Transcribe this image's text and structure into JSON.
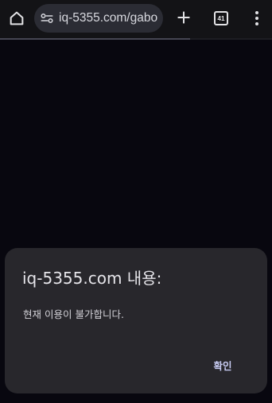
{
  "browser": {
    "url_display": "iq-5355.com/gabo",
    "tab_count": "41",
    "page_load_progress": 0.7,
    "icons": {
      "home": "home-icon",
      "site_info": "tune-icon",
      "new_tab": "plus-icon",
      "tabs": "tab-switcher-icon",
      "menu": "more-vert-icon"
    }
  },
  "dialog": {
    "title": "iq-5355.com 내용:",
    "message": "현재 이용이 불가합니다.",
    "ok_label": "확인"
  },
  "colors": {
    "page_background": "#08070f",
    "toolbar": "#131316",
    "urlbar": "#2b2c34",
    "dialog_background": "#28272c",
    "accent_button_text": "#c7cbf2"
  }
}
